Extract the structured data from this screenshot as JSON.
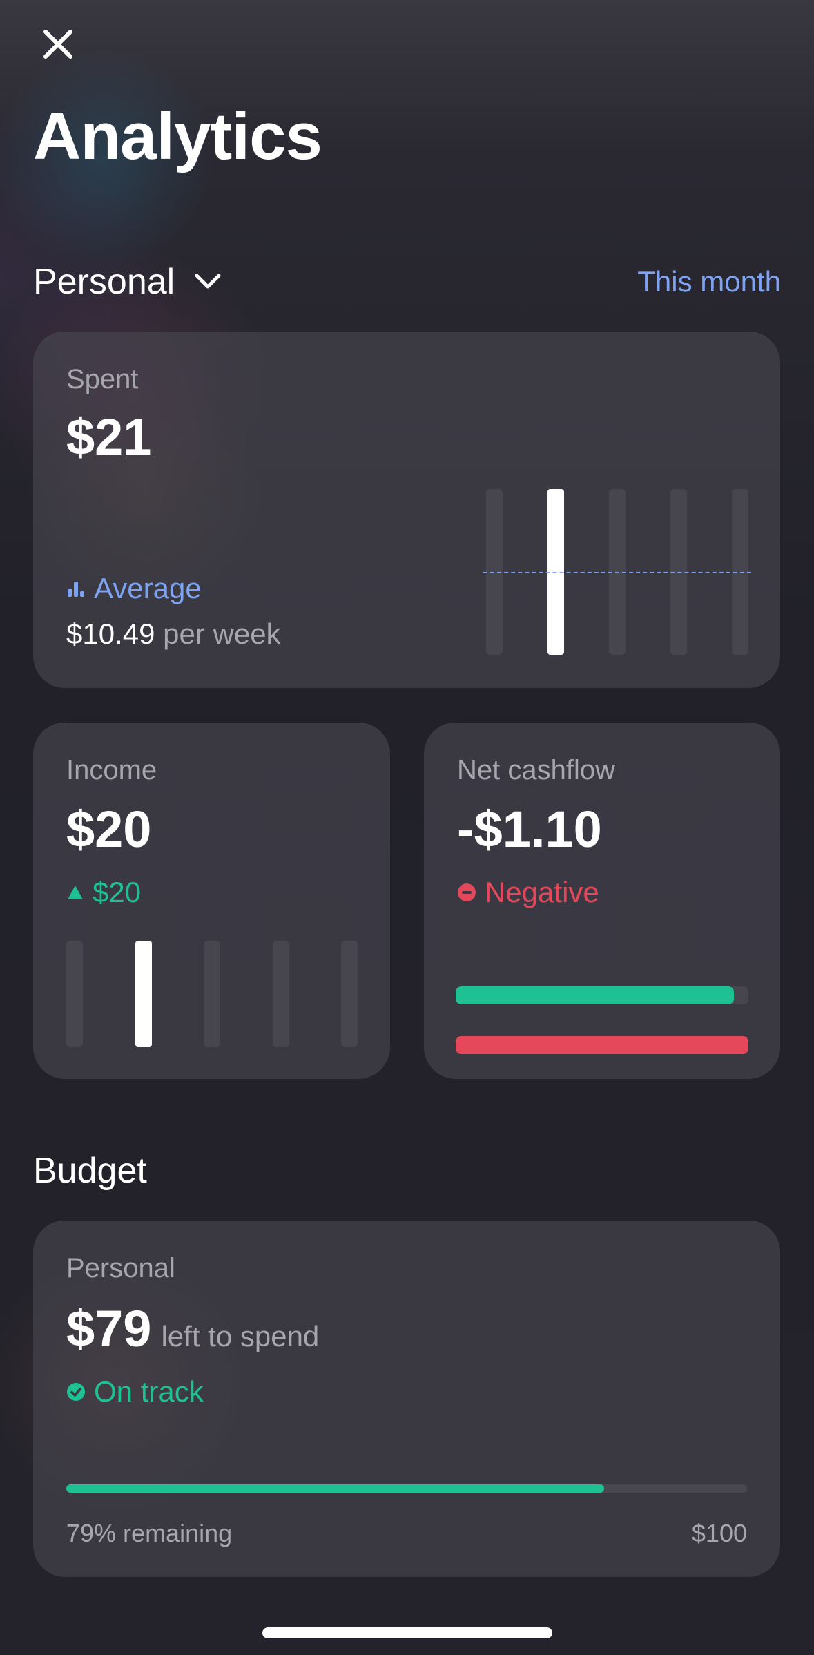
{
  "header": {
    "title": "Analytics",
    "account": "Personal",
    "period": "This month"
  },
  "spent": {
    "label": "Spent",
    "value": "$21",
    "average_label": "Average",
    "average_value": "$10.49",
    "average_unit": "per week",
    "chart_data": {
      "type": "bar",
      "values": [
        0,
        1,
        0,
        0,
        0
      ],
      "average_level": 0.5
    }
  },
  "income": {
    "label": "Income",
    "value": "$20",
    "change": "$20",
    "chart_data": {
      "type": "bar",
      "values": [
        0,
        1,
        0,
        0,
        0
      ]
    }
  },
  "net_cashflow": {
    "label": "Net cashflow",
    "value": "-$1.10",
    "status": "Negative",
    "income_fraction": 0.95,
    "spent_fraction": 1.0
  },
  "budget": {
    "section_title": "Budget",
    "name": "Personal",
    "left_amount": "$79",
    "left_label": "left to spend",
    "status": "On track",
    "remaining_fraction": 0.79,
    "remaining_label": "79% remaining",
    "total": "$100"
  },
  "colors": {
    "accent_blue": "#7fa3f3",
    "positive_green": "#1dc194",
    "negative_red": "#e4485a"
  }
}
